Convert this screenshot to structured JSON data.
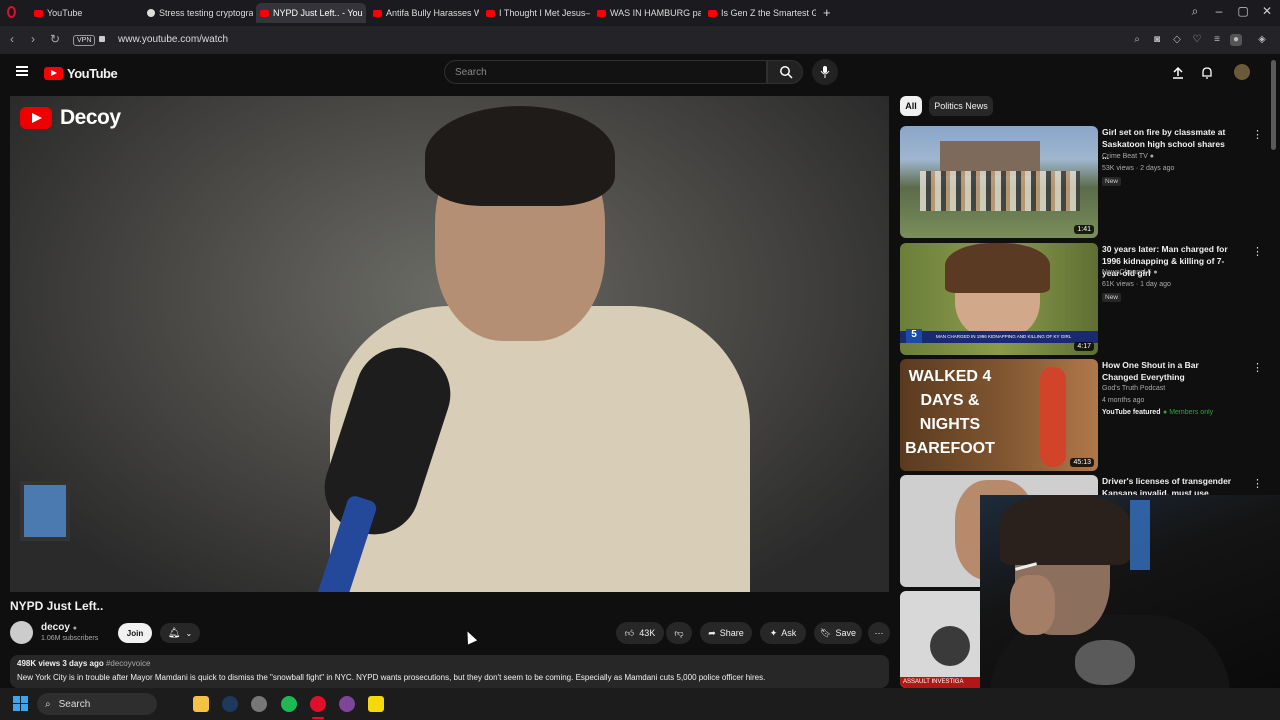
{
  "browser": {
    "tabs": [
      {
        "label": "YouTube",
        "active": false,
        "favicon": "youtube-icon"
      },
      {
        "label": "Stress testing cryptograph",
        "active": false,
        "favicon": "github-icon"
      },
      {
        "label": "NYPD Just Left.. - You",
        "active": true,
        "favicon": "youtube-icon"
      },
      {
        "label": "Antifa Bully Harasses Won",
        "active": false,
        "favicon": "youtube-icon"
      },
      {
        "label": "I Thought I Met Jesus—Bu",
        "active": false,
        "favicon": "youtube-icon"
      },
      {
        "label": "WAS IN HAMBURG passie",
        "active": false,
        "favicon": "youtube-icon"
      },
      {
        "label": "Is Gen Z the Smartest Gen",
        "active": false,
        "favicon": "youtube-icon"
      }
    ],
    "new_tab": "+",
    "vpn_label": "VPN",
    "url": "www.youtube.com/watch"
  },
  "youtube": {
    "logo_text": "YouTube",
    "search_placeholder": "Search"
  },
  "video": {
    "watermark": "Decoy",
    "title": "NYPD Just Left..",
    "channel_name": "decoy",
    "subscribers": "1.06M subscribers",
    "join_label": "Join",
    "likes": "43K",
    "share_label": "Share",
    "ask_label": "Ask",
    "save_label": "Save",
    "meta": "498K views  3 days ago",
    "hashtag": "#decoyvoice",
    "description": "New York City is in trouble after Mayor Mamdani is quick to dismiss the \"snowball fight\" in NYC. NYPD wants prosecutions, but they don't seem to be coming. Especially as Mamdani cuts 5,000 police officer hires."
  },
  "sidebar": {
    "chips": [
      "All",
      "Politics News"
    ],
    "recommendations": [
      {
        "title": "Girl set on fire by classmate at Saskatoon high school shares ...",
        "channel": "Crime Beat TV",
        "meta": "53K views · 2 days ago",
        "badge": "New",
        "duration": "1:41"
      },
      {
        "title": "30 years later: Man charged for 1996 kidnapping & killing of 7-year-old girl",
        "channel": "NewsChannel 5",
        "meta": "61K views · 1 day ago",
        "badge": "New",
        "duration": "4:17",
        "thumb_caption": "MAN CHARGED IN 1996 KIDNAPPING AND KILLING OF KY GIRL"
      },
      {
        "title": "How One Shout in a Bar Changed Everything",
        "channel": "God's Truth Podcast",
        "meta": "4 months ago",
        "featured": "YouTube featured",
        "members": "Members only",
        "duration": "45:13",
        "thumb_text": "WALKED 4 DAYS & NIGHTS BAREFOOT"
      },
      {
        "title": "Driver's licenses of transgender Kansans invalid, must use bathroom...",
        "channel": "",
        "meta": ""
      },
      {
        "title": "",
        "thumb_caption": "ASSAULT INVESTIGA"
      }
    ]
  },
  "taskbar": {
    "search_label": "Search"
  },
  "colors": {
    "youtube_red": "#ff0000",
    "bg": "#0f0f0f",
    "pill_bg": "#272727",
    "members_green": "#2ba640"
  }
}
